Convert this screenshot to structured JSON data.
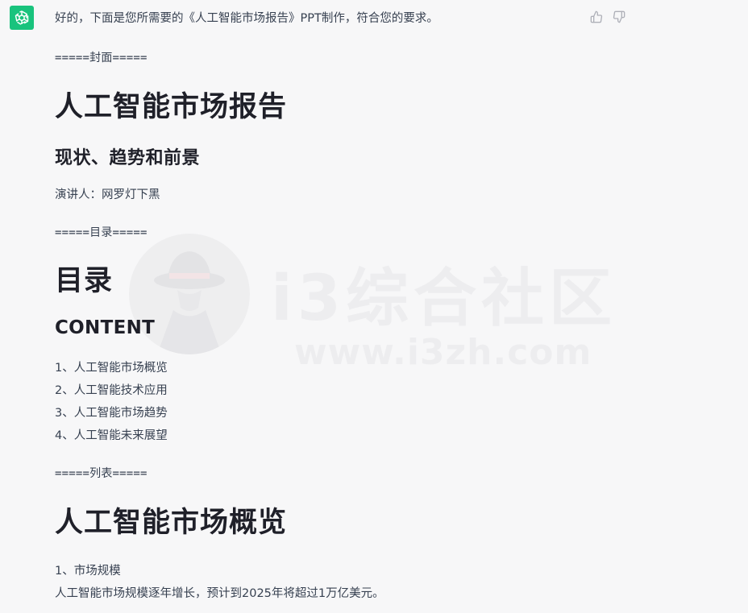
{
  "message": {
    "intro": "好的，下面是您所需要的《人工智能市场报告》PPT制作，符合您的要求。"
  },
  "icons": {
    "avatar": "openai-logo-icon",
    "thumbs_up": "thumbs-up-icon",
    "thumbs_down": "thumbs-down-icon"
  },
  "colors": {
    "avatar_bg": "#19c37d",
    "page_bg": "#f7f7f8",
    "text": "#374151",
    "heading": "#1f2029"
  },
  "slides": {
    "cover": {
      "separator": "=====封面=====",
      "title": "人工智能市场报告",
      "subtitle": "现状、趋势和前景",
      "speaker": "演讲人：网罗灯下黑"
    },
    "toc": {
      "separator": "=====目录=====",
      "title": "目录",
      "subtitle": "CONTENT",
      "items": [
        "1、人工智能市场概览",
        "2、人工智能技术应用",
        "3、人工智能市场趋势",
        "4、人工智能未来展望"
      ]
    },
    "list": {
      "separator": "=====列表=====",
      "title": "人工智能市场概览",
      "item_heading": "1、市场规模",
      "item_text": "人工智能市场规模逐年增长，预计到2025年将超过1万亿美元。"
    }
  },
  "watermark": {
    "title": "i3综合社区",
    "url": "www.i3zh.com"
  }
}
